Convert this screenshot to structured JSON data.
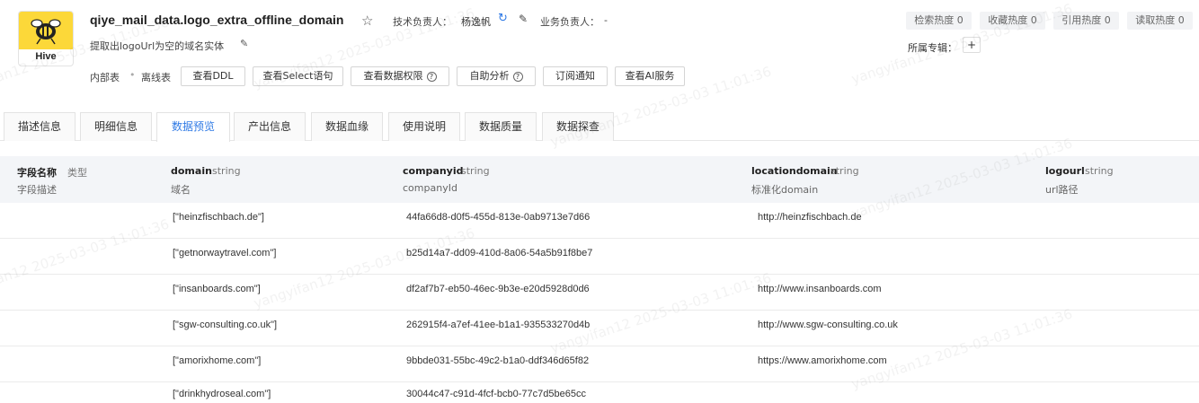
{
  "header": {
    "logo_label": "Hive",
    "title": "qiye_mail_data.logo_extra_offline_domain",
    "owner_label": "技术负责人：",
    "owner_name": "杨逸帆",
    "biz_owner_label": "业务负责人：",
    "biz_owner_value": "-",
    "description": "提取出logoUrl为空的域名实体",
    "tag_internal": "内部表",
    "tag_dot": "•",
    "tag_offline": "离线表",
    "buttons": {
      "view_ddl": "查看DDL",
      "view_select": "查看Select语句",
      "view_permission": "查看数据权限",
      "self_analysis": "自助分析",
      "subscribe": "订阅通知",
      "ai_service": "查看AI服务"
    },
    "help_glyph": "?",
    "stats": {
      "search_heat": "检索热度 0",
      "favorite_heat": "收藏热度 0",
      "reference_heat": "引用热度 0",
      "read_heat": "读取热度 0"
    },
    "topic_label": "所属专辑：",
    "topic_add": "+"
  },
  "tabs": [
    "描述信息",
    "明细信息",
    "数据预览",
    "产出信息",
    "数据血缘",
    "使用说明",
    "数据质量",
    "数据探查"
  ],
  "active_tab": "数据预览",
  "table": {
    "header": {
      "field_name": "字段名称",
      "field_type": "类型",
      "field_desc": "字段描述",
      "columns": [
        {
          "name": "domain",
          "type": "string",
          "desc": "域名"
        },
        {
          "name": "companyid",
          "type": "string",
          "desc": "companyId"
        },
        {
          "name": "locationdomain",
          "type": "string",
          "desc": "标准化domain"
        },
        {
          "name": "logourl",
          "type": "string",
          "desc": "url路径"
        }
      ]
    },
    "rows": [
      {
        "domain": "[\"heinzfischbach.de\"]",
        "companyid": "44fa66d8-d0f5-455d-813e-0ab9713e7d66",
        "locationdomain": "http://heinzfischbach.de",
        "logourl": ""
      },
      {
        "domain": "[\"getnorwaytravel.com\"]",
        "companyid": "b25d14a7-dd09-410d-8a06-54a5b91f8be7",
        "locationdomain": "",
        "logourl": ""
      },
      {
        "domain": "[\"insanboards.com\"]",
        "companyid": "df2af7b7-eb50-46ec-9b3e-e20d5928d0d6",
        "locationdomain": "http://www.insanboards.com",
        "logourl": ""
      },
      {
        "domain": "[\"sgw-consulting.co.uk\"]",
        "companyid": "262915f4-a7ef-41ee-b1a1-935533270d4b",
        "locationdomain": "http://www.sgw-consulting.co.uk",
        "logourl": ""
      },
      {
        "domain": "[\"amorixhome.com\"]",
        "companyid": "9bbde031-55bc-49c2-b1a0-ddf346d65f82",
        "locationdomain": "https://www.amorixhome.com",
        "logourl": ""
      },
      {
        "domain": "[\"drinkhydroseal.com\"]",
        "companyid": "30044c47-c91d-4fcf-bcb0-77c7d5be65cc",
        "locationdomain": "",
        "logourl": ""
      }
    ]
  },
  "watermark": "yangyifan12 2025-03-03 11:01:36",
  "colors": {
    "accent": "#2f7ae5",
    "hive_yellow": "#fcd839",
    "header_bg": "#f3f5f8",
    "stat_bg": "#f2f3f5"
  }
}
